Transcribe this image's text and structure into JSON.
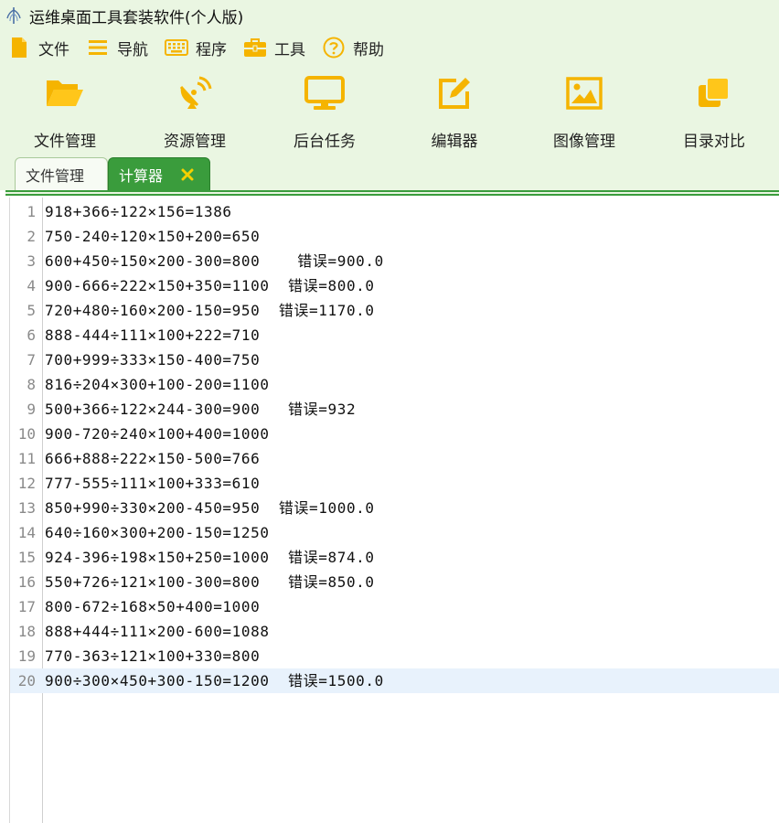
{
  "window": {
    "title": "运维桌面工具套装软件(个人版)",
    "app_icon": "app-logo-icon"
  },
  "menu": [
    {
      "label": "文件",
      "icon": "document-icon"
    },
    {
      "label": "导航",
      "icon": "hamburger-icon"
    },
    {
      "label": "程序",
      "icon": "keyboard-icon"
    },
    {
      "label": "工具",
      "icon": "toolbox-icon"
    },
    {
      "label": "帮助",
      "icon": "help-icon"
    }
  ],
  "toolbar": [
    {
      "label": "文件管理",
      "icon": "folder-open-icon"
    },
    {
      "label": "资源管理",
      "icon": "satellite-dish-icon"
    },
    {
      "label": "后台任务",
      "icon": "monitor-icon"
    },
    {
      "label": "编辑器",
      "icon": "edit-icon"
    },
    {
      "label": "图像管理",
      "icon": "image-icon"
    },
    {
      "label": "目录对比",
      "icon": "copy-icon"
    }
  ],
  "tabs": [
    {
      "label": "文件管理",
      "active": false
    },
    {
      "label": "计算器",
      "active": true,
      "close": "✕"
    }
  ],
  "editor": {
    "current_line": 20,
    "lines": [
      {
        "n": "1",
        "text": "918+366÷122×156=1386"
      },
      {
        "n": "2",
        "text": "750-240÷120×150+200=650"
      },
      {
        "n": "3",
        "text": "600+450÷150×200-300=800    错误=900.0"
      },
      {
        "n": "4",
        "text": "900-666÷222×150+350=1100  错误=800.0"
      },
      {
        "n": "5",
        "text": "720+480÷160×200-150=950  错误=1170.0"
      },
      {
        "n": "6",
        "text": "888-444÷111×100+222=710"
      },
      {
        "n": "7",
        "text": "700+999÷333×150-400=750"
      },
      {
        "n": "8",
        "text": "816÷204×300+100-200=1100"
      },
      {
        "n": "9",
        "text": "500+366÷122×244-300=900   错误=932"
      },
      {
        "n": "10",
        "text": "900-720÷240×100+400=1000"
      },
      {
        "n": "11",
        "text": "666+888÷222×150-500=766"
      },
      {
        "n": "12",
        "text": "777-555÷111×100+333=610"
      },
      {
        "n": "13",
        "text": "850+990÷330×200-450=950  错误=1000.0"
      },
      {
        "n": "14",
        "text": "640÷160×300+200-150=1250"
      },
      {
        "n": "15",
        "text": "924-396÷198×150+250=1000  错误=874.0"
      },
      {
        "n": "16",
        "text": "550+726÷121×100-300=800   错误=850.0"
      },
      {
        "n": "17",
        "text": "800-672÷168×50+400=1000"
      },
      {
        "n": "18",
        "text": "888+444÷111×200-600=1088"
      },
      {
        "n": "19",
        "text": "770-363÷121×100+330=800"
      },
      {
        "n": "20",
        "text": "900÷300×450+300-150=1200  错误=1500.0"
      }
    ]
  },
  "colors": {
    "accent": "#3a9c3c",
    "icon_yellow": "#f5b400",
    "chrome_bg": "#eaf6e2",
    "current_line_bg": "#e8f2fc"
  }
}
